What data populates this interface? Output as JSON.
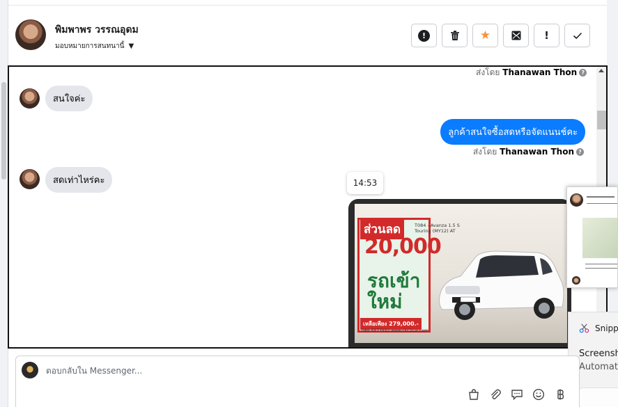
{
  "header": {
    "contact_name": "พิมพาพร วรรณอุดม",
    "assign_label": "มอบหมายการสนทนานี้",
    "actions": [
      {
        "icon": "alert-circle-icon",
        "name": "mark-spam-button"
      },
      {
        "icon": "trash-icon",
        "name": "delete-button"
      },
      {
        "icon": "star-icon",
        "name": "star-button"
      },
      {
        "icon": "mark-unread-icon",
        "name": "mark-unread-button"
      },
      {
        "icon": "exclamation-icon",
        "name": "follow-up-button"
      },
      {
        "icon": "checkmark-icon",
        "name": "mark-done-button"
      }
    ]
  },
  "chat": {
    "sent_by_prefix": "ส่งโดย",
    "top_sent_by": "Thanawan Thon",
    "messages": [
      {
        "direction": "incoming",
        "text": "สนใจค่ะ"
      },
      {
        "direction": "outgoing",
        "text": "ลูกค้าสนใจซื้อสดหรือจัดแนนช์คะ",
        "sent_by": "Thanawan Thon"
      },
      {
        "direction": "incoming",
        "text": "สดเท่าไหร่คะ"
      }
    ],
    "tooltip_time": "14:53",
    "ad": {
      "sale_label": "ส่วนลด",
      "amount": "20,000",
      "model": "T084 - Avanza 1.5 S Touring (MY12) AT",
      "tagline": "รถเข้าใหม่",
      "price": "เหลือเพียง 279,000.-",
      "phone": "089-5577932 www.ckc2car.com"
    }
  },
  "overlay": {
    "app_name": "Snippi",
    "title": "Screensho",
    "subtitle": "Automati"
  },
  "composer": {
    "placeholder": "ตอบกลับใน Messenger...",
    "tools": [
      "shopping-bag-icon",
      "paperclip-icon",
      "saved-reply-icon",
      "emoji-icon",
      "baht-icon"
    ]
  },
  "colors": {
    "outgoing_bubble": "#0a7cff",
    "incoming_bubble": "#e4e6eb",
    "star": "#f7923a",
    "ad_red": "#d22a2a",
    "ad_green": "#1f7a3a"
  }
}
